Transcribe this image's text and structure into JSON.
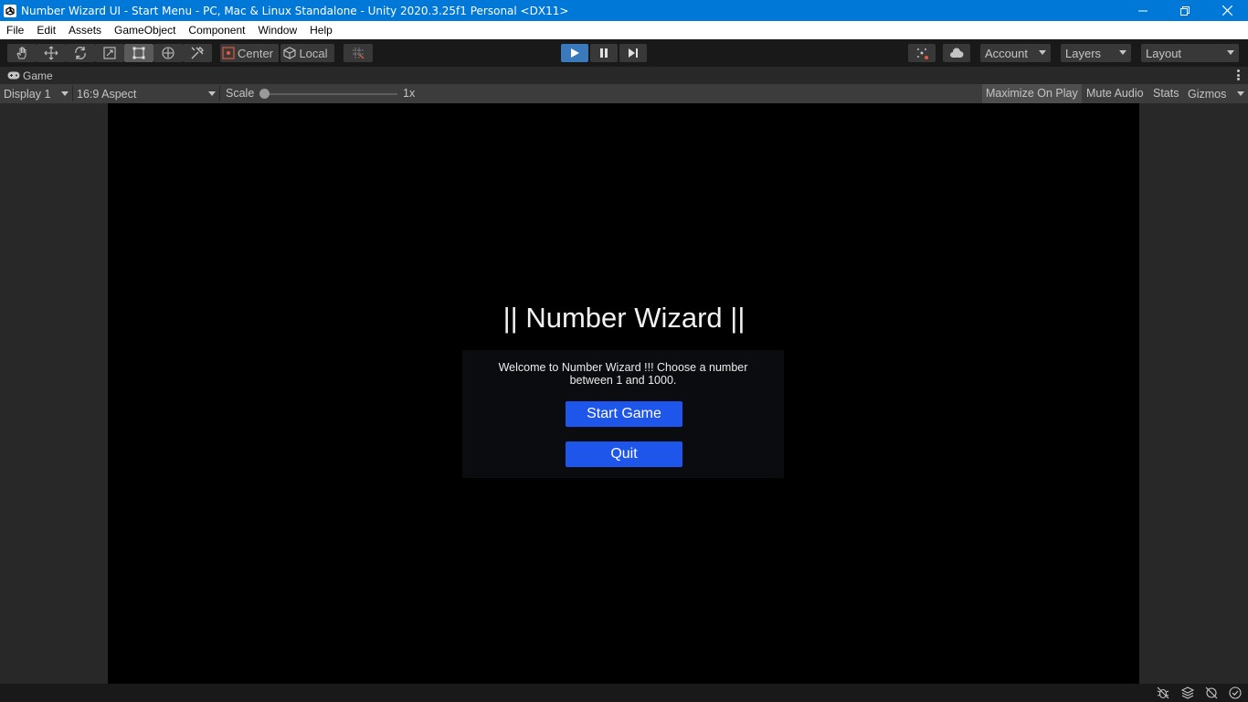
{
  "window": {
    "title": "Number Wizard UI - Start Menu - PC, Mac & Linux Standalone - Unity 2020.3.25f1 Personal <DX11>"
  },
  "menu": [
    "File",
    "Edit",
    "Assets",
    "GameObject",
    "Component",
    "Window",
    "Help"
  ],
  "toolbar": {
    "pivot_label": "Center",
    "space_label": "Local",
    "account_label": "Account",
    "layers_label": "Layers",
    "layout_label": "Layout"
  },
  "tab": {
    "label": "Game"
  },
  "gamebar": {
    "display": "Display 1",
    "aspect": "16:9 Aspect",
    "scale_label": "Scale",
    "scale_value": "1x",
    "maximize_label": "Maximize On Play",
    "mute_label": "Mute Audio",
    "stats_label": "Stats",
    "gizmos_label": "Gizmos"
  },
  "game": {
    "title": "|| Number Wizard ||",
    "welcome": "Welcome to Number Wizard !!! Choose a number between 1 and 1000.",
    "start_button": "Start Game",
    "quit_button": "Quit"
  },
  "colors": {
    "titlebar": "#0078d7",
    "button": "#1e55ea",
    "play_active": "#3a79bb"
  }
}
